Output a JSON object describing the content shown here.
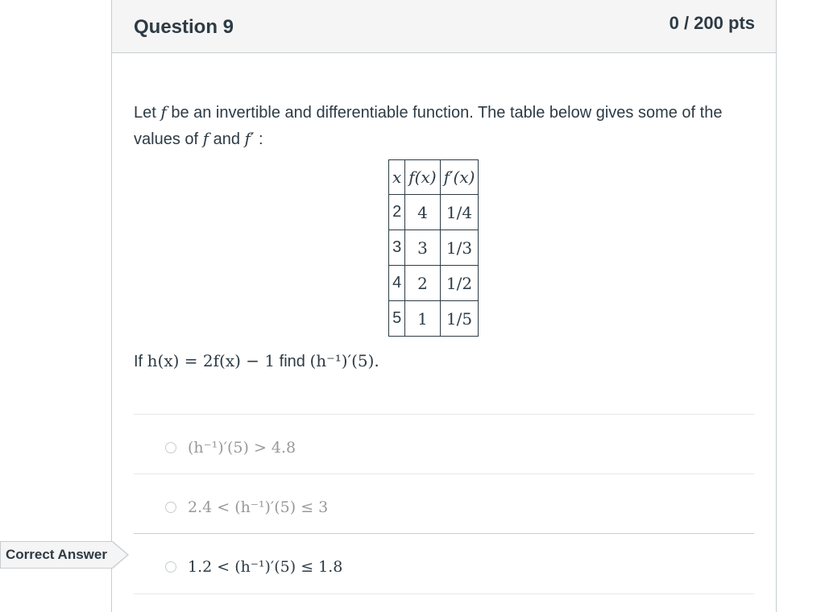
{
  "header": {
    "title": "Question 9",
    "points": "0 / 200 pts"
  },
  "question": {
    "intro_1": "Let ",
    "f_sym": "f",
    "intro_2": " be an invertible and differentiable function. The table below gives some of the values of ",
    "f_sym2": "f",
    "intro_3": " and ",
    "fprime_sym": "f′",
    "intro_4": " :",
    "table": {
      "headers": [
        "x",
        "f(x)",
        "f′(x)"
      ],
      "rows": [
        [
          "2",
          "4",
          "1/4"
        ],
        [
          "3",
          "3",
          "1/3"
        ],
        [
          "4",
          "2",
          "1/2"
        ],
        [
          "5",
          "1",
          "1/5"
        ]
      ]
    },
    "prompt_if": "If ",
    "prompt_expr": "h(x) = 2f(x) − 1",
    "prompt_find": " find ",
    "prompt_target": "(h⁻¹)′(5)",
    "prompt_end": "."
  },
  "answers": [
    {
      "text": "(h⁻¹)′(5) > 4.8",
      "state": "faded"
    },
    {
      "text": "2.4 < (h⁻¹)′(5) ≤ 3",
      "state": "faded"
    },
    {
      "text": "1.2 < (h⁻¹)′(5) ≤ 1.8",
      "state": "correct"
    }
  ],
  "correct_flag": "Correct Answer"
}
